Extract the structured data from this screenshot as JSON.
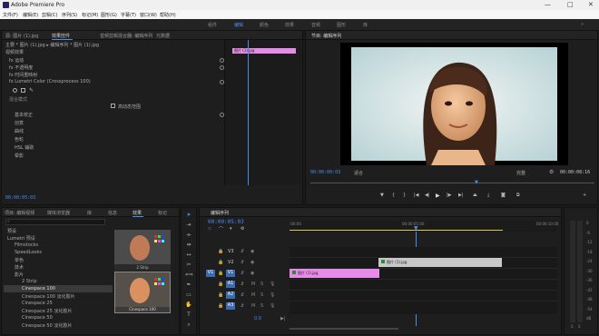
{
  "app": {
    "title": "Adobe Premiere Pro"
  },
  "window_controls": {
    "min": "—",
    "max": "□",
    "close": "✕"
  },
  "menu": [
    "文件(F)",
    "编辑(E)",
    "剪辑(C)",
    "序列(S)",
    "标记(M)",
    "图形(G)",
    "字幕(T)",
    "窗口(W)",
    "帮助(H)"
  ],
  "workspaces": [
    "组件",
    "编辑",
    "颜色",
    "效果",
    "音频",
    "图形",
    "库"
  ],
  "workspace_active": "编辑",
  "effect_controls": {
    "tabs": [
      "源: 图片 (1).jpg",
      "效果控件",
      "音频剪辑混合器: 编辑序列",
      "元数据"
    ],
    "clip_path": "主要 * 图片 (1).jpg   ▸ 编辑序列 * 图片 (1).jpg",
    "section": "视频效果",
    "effects": [
      "fx 运动",
      "fx 不透明度",
      "fx 时间重映射",
      "fx Lumetri Color (Crossprocess 100)"
    ],
    "blend_label": "混合模式",
    "checkbox_label": "高动态范围",
    "subsections": [
      "基本校正",
      "创意",
      "曲线",
      "色轮",
      "HSL 辅助",
      "晕影"
    ],
    "mini_clip": "图片 (1).jpg",
    "timecode": "00:00:05:03"
  },
  "program_monitor": {
    "tab": "节目: 编辑序列",
    "timecode": "00:00:00:03",
    "fit": "适合",
    "quality": "完整",
    "duration": "00:00:08:16"
  },
  "project": {
    "tabs": [
      "项目: 编辑视频",
      "媒体浏览器",
      "库",
      "信息",
      "效果",
      "标记"
    ],
    "active_tab": "效果",
    "search": "",
    "items": [
      "预设",
      "Lumetri 预设",
      "Filmstocks",
      "SpeedLooks",
      "单色",
      "技术",
      "影片",
      "2 Strip",
      "Cinespace 100",
      "Cinespace 100 淡化胶片",
      "Cinespace 25",
      "Cinespace 25 淡化胶片",
      "Cinespace 50",
      "Cinespace 50 淡化胶片"
    ],
    "selected_item": "Cinespace 100",
    "thumb_labels": [
      "2 Strip",
      "Cinespace 100"
    ]
  },
  "timeline": {
    "tab": "编辑序列",
    "timecode": "00:00:05:03",
    "ruler": [
      ":00:00",
      "00:00:05:00",
      "00:00:10:00"
    ],
    "tracks": [
      {
        "name": "V3"
      },
      {
        "name": "V2"
      },
      {
        "name": "V1"
      },
      {
        "name": "A1"
      },
      {
        "name": "A2"
      },
      {
        "name": "A3"
      }
    ],
    "track_state": [
      "M",
      "S"
    ],
    "master": "0.0",
    "clips": [
      {
        "name": "图片 (1).jpg",
        "track": "V2",
        "color": "#c8c8c8"
      },
      {
        "name": "图片 (1).jpg",
        "track": "V1",
        "color": "#e78be8"
      }
    ]
  },
  "audio_meter": {
    "labels": [
      "0",
      "-6",
      "-12",
      "-18",
      "-24",
      "-30",
      "-36",
      "-42",
      "-48",
      "-54",
      "dB"
    ]
  }
}
